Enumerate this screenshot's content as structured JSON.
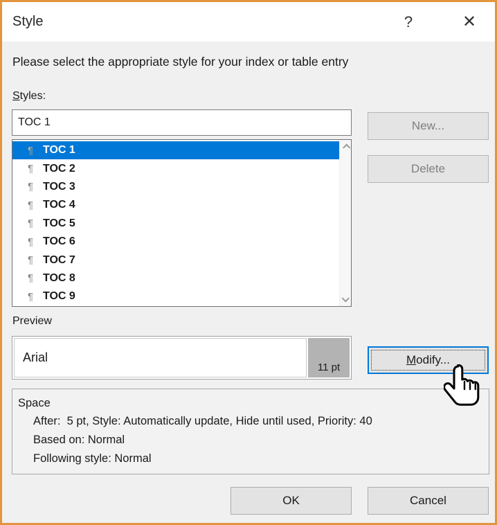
{
  "window": {
    "title": "Style",
    "help_icon": "?",
    "close_icon": "✕"
  },
  "instruction": "Please select the appropriate style for your index or table entry",
  "styles_section": {
    "label": "Styles:",
    "input_value": "TOC 1",
    "item_icon": "¶",
    "item_icon_name": "pilcrow-icon",
    "selected_index": 0,
    "items": [
      "TOC 1",
      "TOC 2",
      "TOC 3",
      "TOC 4",
      "TOC 5",
      "TOC 6",
      "TOC 7",
      "TOC 8",
      "TOC 9"
    ]
  },
  "side_buttons": {
    "new_label": "New...",
    "new_disabled": true,
    "delete_label": "Delete",
    "delete_disabled": true,
    "modify_label": "Modify...",
    "modify_focused": true
  },
  "preview_section": {
    "label": "Preview",
    "font_name": "Arial",
    "font_size": "11 pt"
  },
  "description_section": {
    "title": "Space",
    "lines": [
      "After:  5 pt, Style: Automatically update, Hide until used, Priority: 40",
      "Based on: Normal",
      "Following style: Normal"
    ]
  },
  "footer_buttons": {
    "ok_label": "OK",
    "cancel_label": "Cancel"
  },
  "colors": {
    "frame": "#E2953C",
    "selection": "#0078D7",
    "disabled_text": "#7F7F7F"
  }
}
